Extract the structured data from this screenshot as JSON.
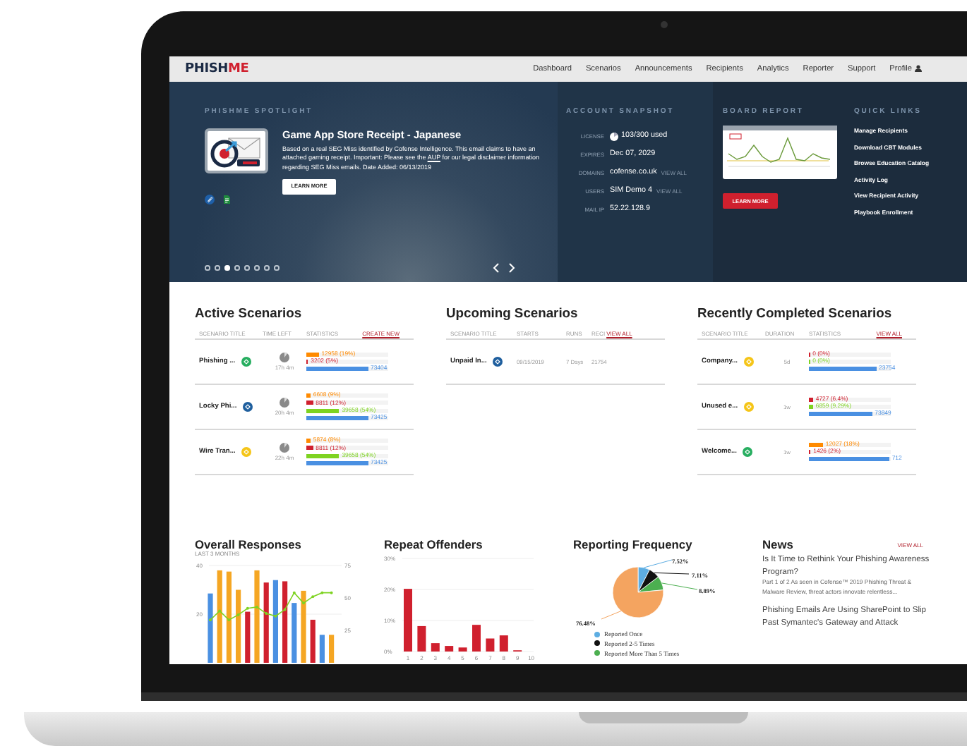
{
  "nav": {
    "logo": {
      "text": "PHISH",
      "accent": "ME"
    },
    "items": [
      {
        "label": "Dashboard",
        "selected": false,
        "kind": "link"
      },
      {
        "label": "Scenarios",
        "selected": false,
        "kind": "link"
      },
      {
        "label": "Announcements",
        "selected": false,
        "kind": "link"
      },
      {
        "label": "Recipients",
        "selected": false,
        "kind": "link"
      },
      {
        "label": "Analytics",
        "selected": false,
        "kind": "link"
      },
      {
        "label": "Reporter",
        "selected": false,
        "kind": "link"
      },
      {
        "label": "Support",
        "selected": false,
        "kind": "link"
      },
      {
        "label": "Profile",
        "selected": false,
        "kind": "profile"
      }
    ]
  },
  "spotlight": {
    "title": "PHISHME SPOTLIGHT",
    "scenario_title": "Game App Store Receipt - Japanese",
    "description": "Based on a real SEG Miss identified by Cofense Intelligence. This email claims to have an attached gaming receipt. Important: Please see the",
    "description_link": "AUP",
    "description_end": "for our legal disclaimer information regarding SEG Miss emails. Date Added: 06/13/2019",
    "button": "LEARN MORE",
    "slides": [
      {
        "selected": false
      },
      {
        "selected": false
      },
      {
        "selected": true
      },
      {
        "selected": false
      },
      {
        "selected": false
      },
      {
        "selected": false
      },
      {
        "selected": false
      },
      {
        "selected": false
      }
    ]
  },
  "snapshot": {
    "title": "ACCOUNT SNAPSHOT",
    "rows": [
      {
        "label": "LICENSE",
        "value": "103/300 used",
        "kind": "license"
      },
      {
        "label": "EXPIRES",
        "value": "Dec 07, 2029",
        "kind": "text"
      },
      {
        "label": "DOMAINS",
        "value": "cofense.co.uk",
        "link": "VIEW ALL",
        "kind": "text"
      },
      {
        "label": "USERS",
        "value": "SIM Demo 4",
        "link": "VIEW ALL",
        "kind": "text"
      },
      {
        "label": "MAIL IP",
        "value": "52.22.128.9",
        "kind": "text"
      }
    ]
  },
  "board_report": {
    "title": "BOARD REPORT",
    "button": "LEARN MORE"
  },
  "quick_links": {
    "title": "QUICK LINKS",
    "links": [
      "Manage Recipients",
      "Download CBT Modules",
      "Browse Education Catalog",
      "Activity Log",
      "View Recipient Activity",
      "Playbook Enrollment"
    ]
  },
  "scenario_panels": [
    {
      "kind": "active",
      "title": "Active Scenarios",
      "columns": [
        "SCENARIO TITLE",
        "TIME LEFT",
        "STATISTICS"
      ],
      "action": "CREATE NEW",
      "rows": [
        {
          "name": "Phishing ...",
          "color": "#27ae60",
          "time": "17h 4m",
          "stats": [
            {
              "value": "12958 (19%)",
              "color": "#ff8a00",
              "level": 0.15
            },
            {
              "value": "3202 (5%)",
              "color": "#d0202e",
              "level": 0.02
            },
            {
              "value": "73404",
              "color": "#4a90e2",
              "level": 0.75
            }
          ]
        },
        {
          "name": "Locky Phi...",
          "color": "#1f5f9e",
          "time": "20h 4m",
          "stats": [
            {
              "value": "6608 (9%)",
              "color": "#ff8a00",
              "level": 0.05
            },
            {
              "value": "8811 (12%)",
              "color": "#d0202e",
              "level": 0.08
            },
            {
              "value": "39658 (54%)",
              "color": "#7ed321",
              "level": 0.4
            },
            {
              "value": "73425",
              "color": "#4a90e2",
              "level": 0.75
            }
          ]
        },
        {
          "name": "Wire Tran...",
          "color": "#f5c518",
          "time": "22h 4m",
          "stats": [
            {
              "value": "5874 (8%)",
              "color": "#ff8a00",
              "level": 0.05
            },
            {
              "value": "8811 (12%)",
              "color": "#d0202e",
              "level": 0.08
            },
            {
              "value": "39658 (54%)",
              "color": "#7ed321",
              "level": 0.4
            },
            {
              "value": "73425",
              "color": "#4a90e2",
              "level": 0.75
            }
          ]
        }
      ]
    },
    {
      "kind": "upcoming",
      "title": "Upcoming Scenarios",
      "columns": [
        "SCENARIO TITLE",
        "STARTS",
        "RUNS",
        "RECI"
      ],
      "action": "VIEW ALL",
      "rows": [
        {
          "color": "#1f5f9e",
          "cells": [
            "Unpaid In...",
            "09/15/2019",
            "7 Days",
            "21754"
          ]
        }
      ]
    },
    {
      "kind": "completed",
      "title": "Recently Completed Scenarios",
      "columns": [
        "SCENARIO TITLE",
        "DURATION",
        "STATISTICS"
      ],
      "action": "VIEW ALL",
      "rows": [
        {
          "name": "Company...",
          "color": "#f5c518",
          "time": "5d",
          "stats": [
            {
              "value": "0 (0%)",
              "color": "#d0202e",
              "level": 0.01
            },
            {
              "value": "0 (0%)",
              "color": "#7ed321",
              "level": 0.01
            },
            {
              "value": "23754",
              "color": "#4a90e2",
              "level": 0.82
            }
          ]
        },
        {
          "name": "Unused e...",
          "color": "#f5c518",
          "time": "1w",
          "stats": [
            {
              "value": "4727 (6.4%)",
              "color": "#d0202e",
              "level": 0.05
            },
            {
              "value": "6859 (9.29%)",
              "color": "#7ed321",
              "level": 0.05
            },
            {
              "value": "73849",
              "color": "#4a90e2",
              "level": 0.77
            }
          ]
        },
        {
          "name": "Welcome...",
          "color": "#27ae60",
          "time": "1w",
          "stats": [
            {
              "value": "12027 (18%)",
              "color": "#ff8a00",
              "level": 0.17
            },
            {
              "value": "1426 (2%)",
              "color": "#d0202e",
              "level": 0.02
            },
            {
              "value": "712",
              "color": "#4a90e2",
              "level": 0.98
            }
          ]
        }
      ]
    }
  ],
  "overall_responses": {
    "title": "Overall Responses",
    "subtitle": "LAST 3 MONTHS",
    "bars": {
      "chart_data": {
        "type": "bar",
        "ylim": [
          0,
          40
        ],
        "yticks": [
          20,
          40
        ],
        "series": [
          {
            "color": "#4a90e2",
            "values": [
              28.5,
              null,
              null,
              null,
              null,
              null,
              null,
              34,
              null,
              24.6,
              null,
              null,
              11.5,
              null
            ]
          },
          {
            "color": "#f5a623",
            "values": [
              null,
              38,
              37.5,
              30,
              null,
              38,
              null,
              null,
              null,
              null,
              29.6,
              null,
              null,
              11.5
            ]
          },
          {
            "color": "#d0202e",
            "values": [
              null,
              null,
              null,
              null,
              21,
              null,
              33,
              null,
              33.5,
              null,
              null,
              17.7,
              null,
              null
            ]
          }
        ]
      }
    },
    "trend": {
      "chart_data": {
        "type": "line",
        "ylim": [
          25,
          75
        ],
        "yticks": [
          25,
          50,
          75
        ],
        "series": [
          {
            "color": "#7ed321",
            "values": [
              33,
              40,
              33,
              37,
              42,
              43,
              38,
              36,
              41,
              54,
              46,
              51,
              54,
              54
            ]
          }
        ]
      }
    }
  },
  "repeat_offenders": {
    "title": "Repeat Offenders",
    "chart_data": {
      "type": "bar",
      "categories": [
        "1",
        "2",
        "3",
        "4",
        "5",
        "6",
        "7",
        "8",
        "9",
        "10"
      ],
      "values": [
        20.2,
        8.2,
        2.7,
        1.8,
        1.3,
        8.6,
        4.2,
        5.2,
        0.4,
        0
      ],
      "ylim": [
        0,
        30
      ],
      "yticks": [
        {
          "value": 0,
          "label": "0%"
        },
        {
          "value": 10,
          "label": "10%"
        },
        {
          "value": 20,
          "label": "20%"
        },
        {
          "value": 30,
          "label": "30%"
        }
      ]
    }
  },
  "reporting_frequency": {
    "title": "Reporting Frequency",
    "chart_data": {
      "type": "pie",
      "values": [
        7.52,
        7.11,
        8.89,
        76.48
      ],
      "value_labels": [
        "7.52%",
        "7.11%",
        "8.89%",
        "76.48%"
      ],
      "colors": [
        "#5dade2",
        "#111111",
        "#4caf50",
        "#f4a460"
      ]
    },
    "legend": [
      {
        "label": "Reported Once",
        "color": "#5dade2"
      },
      {
        "label": "Reported 2-5 Times",
        "color": "#111111"
      },
      {
        "label": "Reported More Than 5 Times",
        "color": "#4caf50"
      }
    ]
  },
  "news": {
    "title": "News",
    "action": "VIEW ALL",
    "articles": [
      {
        "title": "Is It Time to Rethink Your Phishing Awareness Program?",
        "excerpt": "Part 1 of 2 As seen in Cofense™ 2019 Phishing Threat & Malware Review, threat actors innovate relentless..."
      },
      {
        "title": "Phishing Emails Are Using SharePoint to Slip Past Symantec's Gateway and Attack"
      }
    ]
  }
}
